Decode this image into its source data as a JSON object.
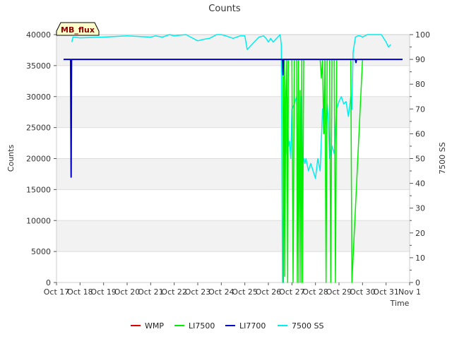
{
  "chart_data": {
    "type": "line",
    "title": "Counts",
    "xlabel": "Time",
    "ylabel": "Counts",
    "y2label": "7500 SS",
    "badge": "MB_flux",
    "xlim": [
      17,
      32
    ],
    "ylim": [
      0,
      40000
    ],
    "y2lim": [
      0,
      100
    ],
    "x_ticks": [
      "Oct 17",
      "Oct 18",
      "Oct 19",
      "Oct 20",
      "Oct 21",
      "Oct 22",
      "Oct 23",
      "Oct 24",
      "Oct 25",
      "Oct 26",
      "Oct 27",
      "Oct 28",
      "Oct 29",
      "Oct 30",
      "Oct 31",
      "Nov 1"
    ],
    "y_ticks": [
      0,
      5000,
      10000,
      15000,
      20000,
      25000,
      30000,
      35000,
      40000
    ],
    "y2_ticks": [
      0,
      10,
      20,
      30,
      40,
      50,
      60,
      70,
      80,
      90,
      100
    ],
    "legend": {
      "position": "bottom-center"
    },
    "colors": {
      "WMP": "#dd0000",
      "LI7500": "#00ee00",
      "LI7700": "#0000cc",
      "7500 SS": "#00eeee",
      "band": "#f2f2f2",
      "grid": "#dddddd"
    },
    "series": [
      {
        "name": "WMP",
        "axis": "left",
        "x": [],
        "y": []
      },
      {
        "name": "LI7500",
        "axis": "left",
        "x": [
          26.6,
          26.62,
          26.64,
          26.68,
          26.7,
          26.74,
          26.78,
          26.82,
          26.85,
          27.0,
          27.05,
          27.1,
          27.2,
          27.23,
          27.28,
          27.3,
          27.35,
          27.38,
          27.42,
          27.45,
          27.5,
          28.2,
          28.25,
          28.3,
          28.35,
          28.4,
          28.45,
          28.5,
          28.6,
          28.65,
          28.7,
          28.8,
          28.85,
          28.9,
          29.5,
          29.55,
          30.0
        ],
        "y": [
          36000,
          36000,
          0,
          36000,
          1000,
          30500,
          36000,
          0,
          36000,
          36000,
          0,
          36000,
          36000,
          0,
          36000,
          0,
          31000,
          0,
          36000,
          0,
          36000,
          36000,
          33000,
          36000,
          24000,
          36000,
          0,
          36000,
          36000,
          0,
          36000,
          36000,
          0,
          36000,
          36000,
          0,
          36000
        ]
      },
      {
        "name": "LI7700",
        "axis": "left",
        "x": [
          17.3,
          17.6,
          17.62,
          17.64,
          17.66,
          17.68,
          26.6,
          26.62,
          26.64,
          26.66,
          29.7,
          29.72,
          29.74,
          29.76,
          31.7
        ],
        "y": [
          36000,
          36000,
          17000,
          36000,
          36000,
          36000,
          36000,
          33500,
          36000,
          36000,
          36000,
          35500,
          36000,
          36000,
          36000
        ]
      },
      {
        "name": "7500 SS",
        "axis": "right",
        "x": [
          17.65,
          17.7,
          18.0,
          19.0,
          20.0,
          21.0,
          21.2,
          21.5,
          21.8,
          22.0,
          22.5,
          23.0,
          23.2,
          23.5,
          23.8,
          24.0,
          24.2,
          24.5,
          24.8,
          25.0,
          25.1,
          25.3,
          25.6,
          25.8,
          25.9,
          26.0,
          26.1,
          26.2,
          26.5,
          26.55,
          26.6,
          26.65,
          26.7,
          26.75,
          26.8,
          26.85,
          26.9,
          26.95,
          27.0,
          27.1,
          27.2,
          27.25,
          27.3,
          27.35,
          27.4,
          27.45,
          27.5,
          27.55,
          27.6,
          27.7,
          27.8,
          27.9,
          28.0,
          28.1,
          28.2,
          28.3,
          28.4,
          28.5,
          28.55,
          28.6,
          28.7,
          28.8,
          28.9,
          29.0,
          29.1,
          29.2,
          29.3,
          29.4,
          29.5,
          29.55,
          29.6,
          29.7,
          29.8,
          29.9,
          30.0,
          30.2,
          30.5,
          30.8,
          31.0,
          31.1,
          31.2
        ],
        "y": [
          97,
          99,
          98.7,
          99,
          99.5,
          99,
          99.5,
          99,
          100,
          99.5,
          100,
          97.5,
          98,
          98.5,
          100,
          100,
          99.5,
          98.5,
          99.5,
          99.5,
          94,
          96,
          99,
          99.5,
          98.5,
          97,
          98.5,
          97,
          100,
          96,
          0,
          40,
          75,
          52,
          75,
          55,
          57,
          50,
          70,
          72,
          75,
          45,
          46,
          40,
          75,
          48,
          50,
          48,
          50,
          45,
          48,
          45,
          42,
          50,
          45,
          70,
          60,
          72,
          65,
          50,
          55,
          52,
          70,
          73,
          75,
          72,
          73,
          67,
          75,
          70,
          93,
          99,
          99.5,
          99.5,
          99,
          100,
          100,
          100,
          97,
          95,
          96
        ]
      }
    ]
  }
}
